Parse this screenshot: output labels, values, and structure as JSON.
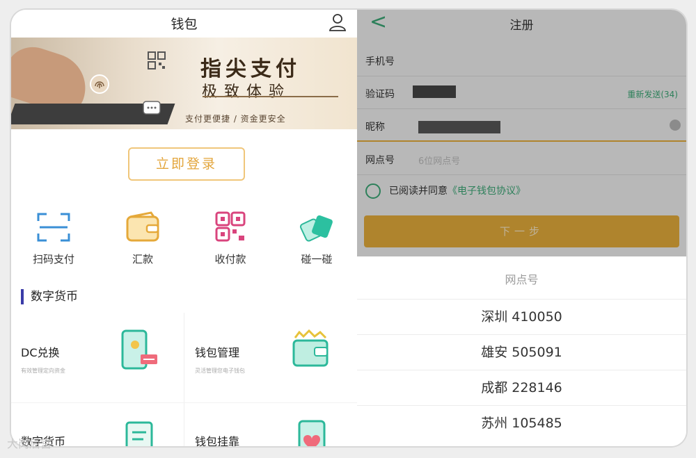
{
  "left": {
    "header": {
      "title": "钱包"
    },
    "banner": {
      "title": "指尖支付",
      "subtitle": "极致体验",
      "tagline": "支付更便捷 / 资金更安全"
    },
    "login_button": "立即登录",
    "quick_actions": [
      {
        "label": "扫码支付",
        "icon": "scan-icon"
      },
      {
        "label": "汇款",
        "icon": "wallet-icon"
      },
      {
        "label": "收付款",
        "icon": "qr-code-icon"
      },
      {
        "label": "碰一碰",
        "icon": "tap-cards-icon"
      }
    ],
    "section_title": "数字货币",
    "cards": [
      {
        "title": "DC兑换",
        "subtitle": "有效管理定向资金",
        "icon": "phone-exchange-icon"
      },
      {
        "title": "钱包管理",
        "subtitle": "灵活管理您电子钱包",
        "icon": "wallet-manage-icon"
      },
      {
        "title": "数字货币",
        "subtitle": "",
        "icon": "document-icon"
      },
      {
        "title": "钱包挂靠",
        "subtitle": "",
        "icon": "phone-heart-icon"
      }
    ]
  },
  "right": {
    "header": {
      "title": "注册",
      "back": "<"
    },
    "fields": [
      {
        "label": "手机号"
      },
      {
        "label": "验证码",
        "action": "重新发送(34)"
      },
      {
        "label": "昵称"
      },
      {
        "label": "网点号",
        "placeholder": "6位网点号"
      }
    ],
    "agree_text": "已阅读并同意",
    "agree_link": "《电子钱包协议》",
    "next_button": "下一步",
    "picker": {
      "title": "网点号",
      "options": [
        "深圳 410050",
        "雄安 505091",
        "成都 228146",
        "苏州 105485"
      ]
    }
  },
  "watermark": "大岗后宫"
}
